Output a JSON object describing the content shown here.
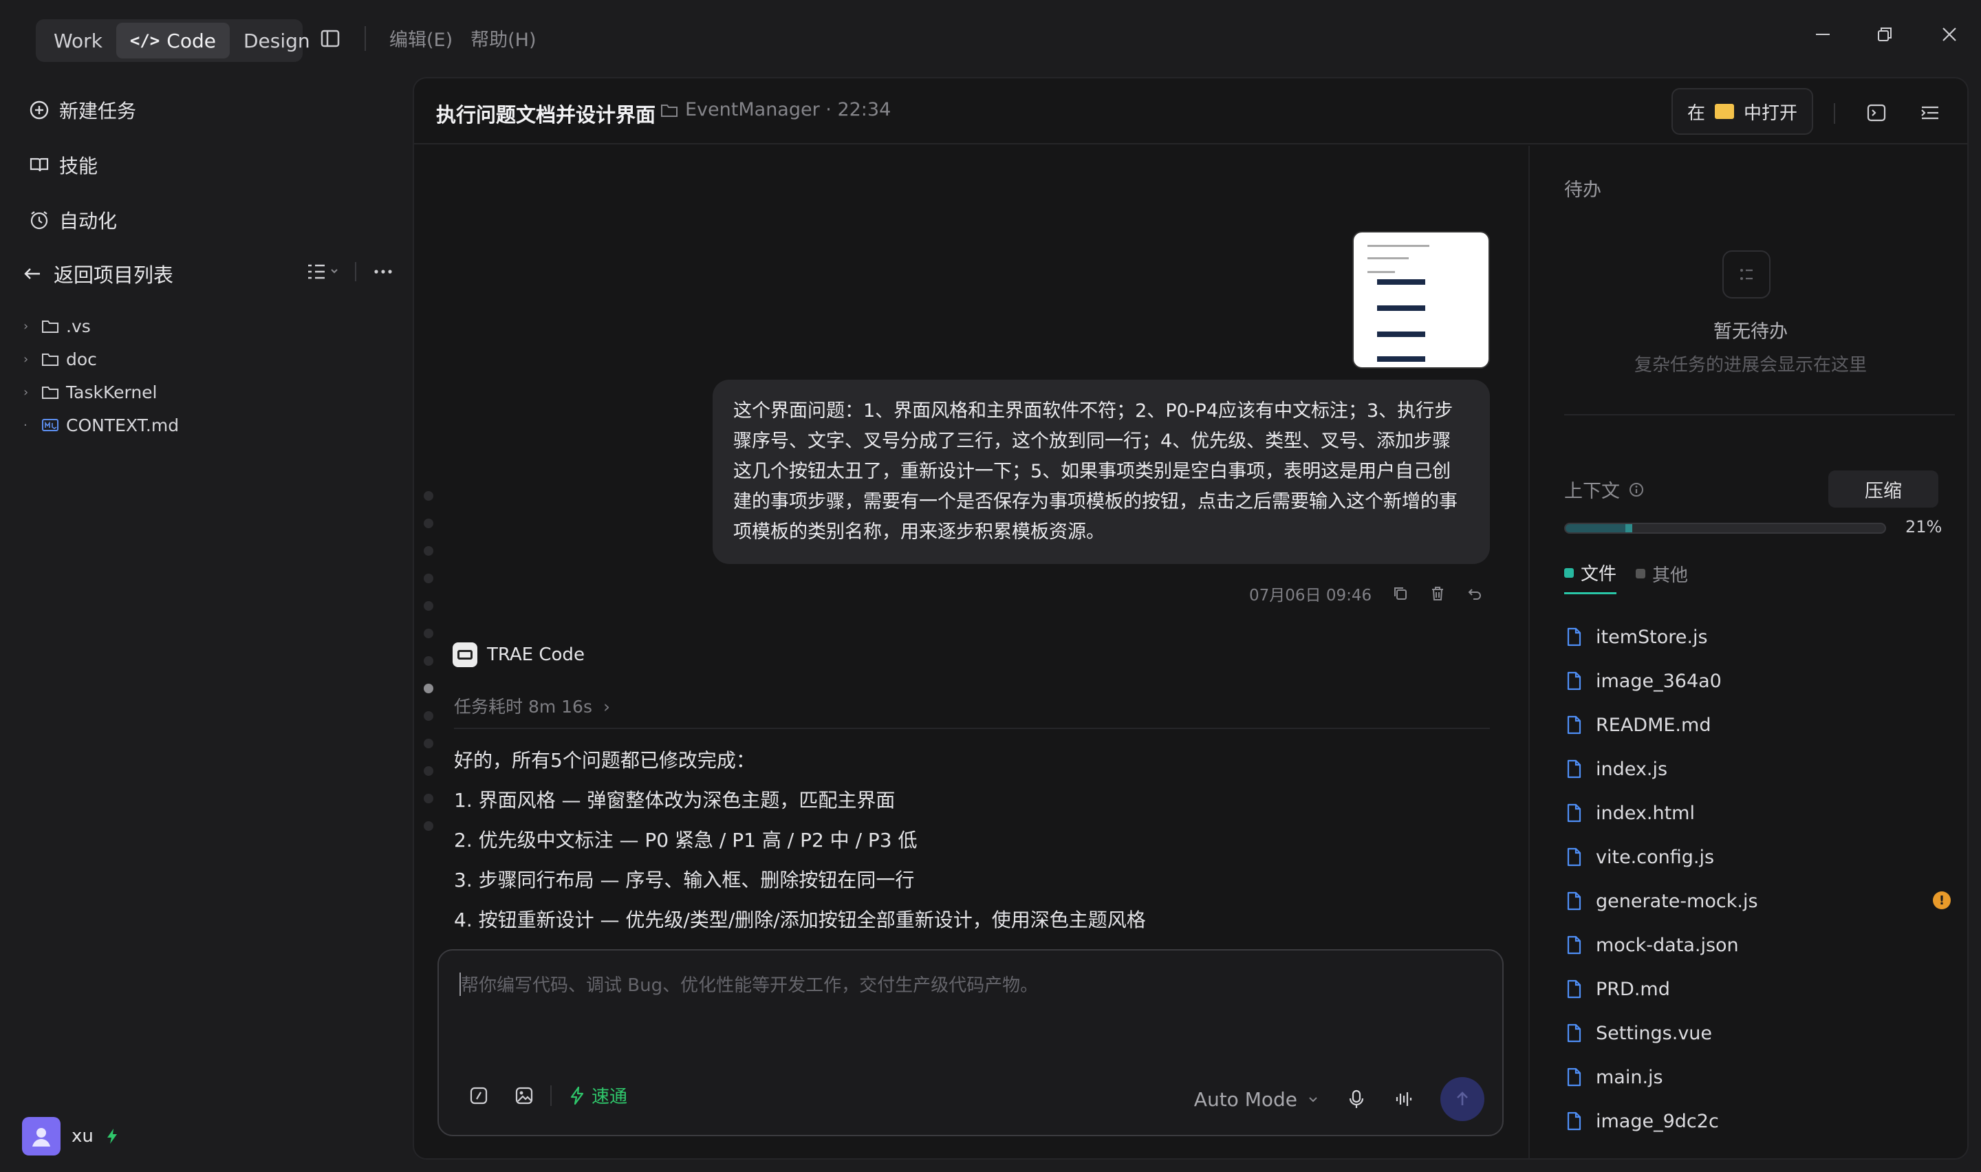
{
  "titlebar": {
    "modes": [
      "Work",
      "Code",
      "Design"
    ],
    "active_mode": "Code",
    "menu": [
      "编辑(E)",
      "帮助(H)"
    ]
  },
  "sidebar": {
    "nav": [
      "新建任务",
      "技能",
      "自动化"
    ],
    "back_label": "返回项目列表",
    "tree": [
      {
        "name": ".vs",
        "type": "folder"
      },
      {
        "name": "doc",
        "type": "folder"
      },
      {
        "name": "TaskKernel",
        "type": "folder"
      },
      {
        "name": "CONTEXT.md",
        "type": "file"
      }
    ],
    "user_name": "xu"
  },
  "header": {
    "title": "执行问题文档并设计界面",
    "project": "EventManager · 22:34",
    "open_in_prefix": "在",
    "open_in_suffix": "中打开"
  },
  "chat": {
    "user_message": "这个界面问题：1、界面风格和主界面软件不符；2、P0-P4应该有中文标注；3、执行步骤序号、文字、叉号分成了三行，这个放到同一行；4、优先级、类型、叉号、添加步骤这几个按钮太丑了，重新设计一下；5、如果事项类别是空白事项，表明这是用户自己创建的事项步骤，需要有一个是否保存为事项模板的按钮，点击之后需要输入这个新增的事项模板的类别名称，用来逐步积累模板资源。",
    "user_time": "07月06日 09:46",
    "ai_name": "TRAE Code",
    "task_time": "任务耗时 8m 16s",
    "ai_intro": "好的，所有5个问题都已修改完成：",
    "ai_items": [
      "1. 界面风格 — 弹窗整体改为深色主题，匹配主界面",
      "2. 优先级中文标注 — P0 紧急 / P1 高 / P2 中 / P3 低",
      "3. 步骤同行布局 — 序号、输入框、删除按钮在同一行",
      "4. 按钮重新设计 — 优先级/类型/删除/添加按钮全部重新设计，使用深色主题风格"
    ]
  },
  "composer": {
    "placeholder": "帮你编写代码、调试 Bug、优化性能等开发工作，交付生产级代码产物。",
    "fast_label": "速通",
    "mode": "Auto Mode"
  },
  "right_panel": {
    "todo_title": "待办",
    "empty_title": "暂无待办",
    "empty_sub": "复杂任务的进展会显示在这里",
    "context_label": "上下文",
    "compress_label": "压缩",
    "context_percent": "21%",
    "context_fraction": 0.21,
    "tabs": [
      "文件",
      "其他"
    ],
    "files": [
      {
        "name": "itemStore.js",
        "warn": false
      },
      {
        "name": "image_364a0",
        "warn": false
      },
      {
        "name": "README.md",
        "warn": false
      },
      {
        "name": "index.js",
        "warn": false
      },
      {
        "name": "index.html",
        "warn": false
      },
      {
        "name": "vite.config.js",
        "warn": false
      },
      {
        "name": "generate-mock.js",
        "warn": true
      },
      {
        "name": "mock-data.json",
        "warn": false
      },
      {
        "name": "PRD.md",
        "warn": false
      },
      {
        "name": "Settings.vue",
        "warn": false
      },
      {
        "name": "main.js",
        "warn": false
      },
      {
        "name": "image_9dc2c",
        "warn": false
      }
    ]
  },
  "colors": {
    "accent_green": "#2fc76b",
    "accent_teal": "#27b8a0",
    "warn": "#e89a2a",
    "avatar": "#7b6cf2",
    "file_icon": "#4f8ff7"
  }
}
